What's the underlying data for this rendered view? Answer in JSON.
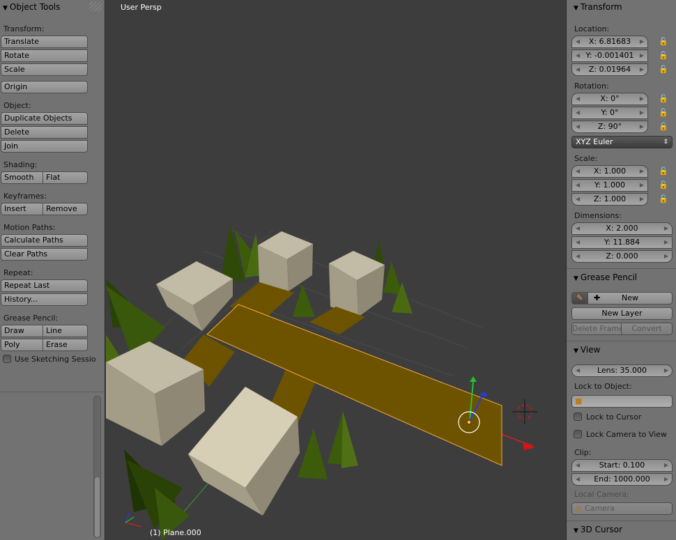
{
  "left_panel": {
    "title": "Object Tools",
    "transform_label": "Transform:",
    "translate": "Translate",
    "rotate": "Rotate",
    "scale": "Scale",
    "origin": "Origin",
    "object_label": "Object:",
    "duplicate": "Duplicate Objects",
    "delete": "Delete",
    "join": "Join",
    "shading_label": "Shading:",
    "smooth": "Smooth",
    "flat": "Flat",
    "keyframes_label": "Keyframes:",
    "insert": "Insert",
    "remove": "Remove",
    "motion_label": "Motion Paths:",
    "calc_paths": "Calculate Paths",
    "clear_paths": "Clear Paths",
    "repeat_label": "Repeat:",
    "repeat_last": "Repeat Last",
    "history": "History...",
    "grease_label": "Grease Pencil:",
    "draw": "Draw",
    "line": "Line",
    "poly": "Poly",
    "erase": "Erase",
    "sketching": "Use Sketching Sessio"
  },
  "viewport": {
    "view_name": "User Persp",
    "object_info": "(1) Plane.000"
  },
  "right_panel": {
    "transform_title": "Transform",
    "location_label": "Location:",
    "loc_x": "X: 6.81683",
    "loc_y": "Y: -0.001401",
    "loc_z": "Z: 0.01964",
    "rotation_label": "Rotation:",
    "rot_x": "X: 0°",
    "rot_y": "Y: 0°",
    "rot_z": "Z: 90°",
    "rotation_mode": "XYZ Euler",
    "scale_label": "Scale:",
    "sc_x": "X: 1.000",
    "sc_y": "Y: 1.000",
    "sc_z": "Z: 1.000",
    "dimensions_label": "Dimensions:",
    "dim_x": "X: 2.000",
    "dim_y": "Y: 11.884",
    "dim_z": "Z: 0.000",
    "grease_title": "Grease Pencil",
    "new": "New",
    "new_layer": "New Layer",
    "delete_frame": "Delete Frame",
    "convert": "Convert",
    "view_title": "View",
    "lens": "Lens: 35.000",
    "lock_object_label": "Lock to Object:",
    "lock_cursor": "Lock to Cursor",
    "lock_camera": "Lock Camera to View",
    "clip_label": "Clip:",
    "clip_start": "Start: 0.100",
    "clip_end": "End: 1000.000",
    "local_camera_label": "Local Camera:",
    "camera": "Camera",
    "cursor_title": "3D Cursor"
  },
  "colors": {
    "panel_bg": "#727272",
    "viewport_bg": "#3d3d3d",
    "selected_plane": "#6d5300",
    "selection_outline": "#f0a030",
    "box_light": "#b0a990"
  }
}
